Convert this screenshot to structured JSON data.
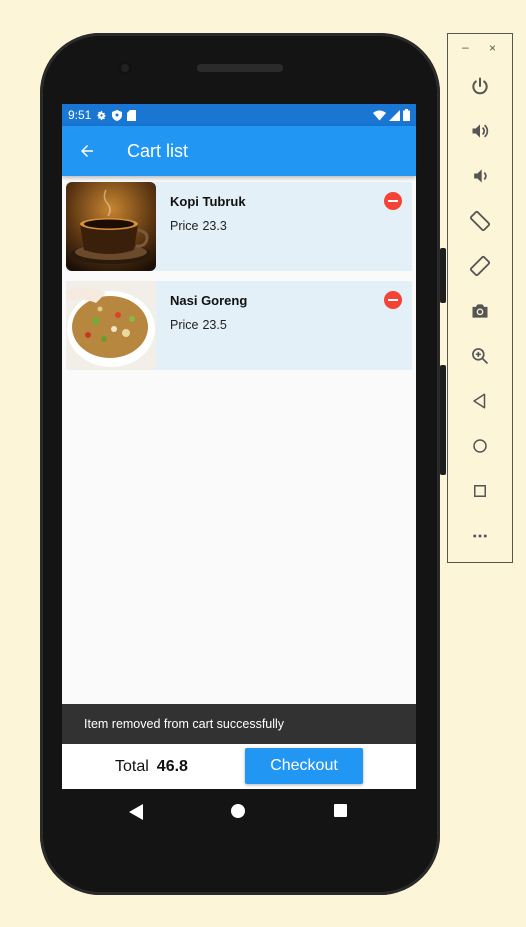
{
  "status_bar": {
    "time": "9:51"
  },
  "app_bar": {
    "title": "Cart list"
  },
  "cart": {
    "items": [
      {
        "name": "Kopi Tubruk",
        "price_label": "Price",
        "price": "23.3"
      },
      {
        "name": "Nasi Goreng",
        "price_label": "Price",
        "price": "23.5"
      }
    ],
    "total_label": "Total",
    "total_value": "46.8",
    "checkout_label": "Checkout"
  },
  "snackbar": {
    "message": "Item removed from cart successfully"
  },
  "emulator_panel": {
    "minimize": "–",
    "close": "×",
    "buttons": [
      "power-icon",
      "volume-up-icon",
      "volume-down-icon",
      "rotate-left-icon",
      "rotate-right-icon",
      "camera-icon",
      "zoom-icon",
      "back-icon",
      "home-icon",
      "overview-icon",
      "more-icon"
    ]
  },
  "colors": {
    "primary": "#2196f3",
    "status_bar": "#1976d2",
    "card_bg": "#e3f0f7",
    "remove": "#f44336",
    "snackbar": "#323232",
    "page_bg": "#fdf5d8"
  }
}
